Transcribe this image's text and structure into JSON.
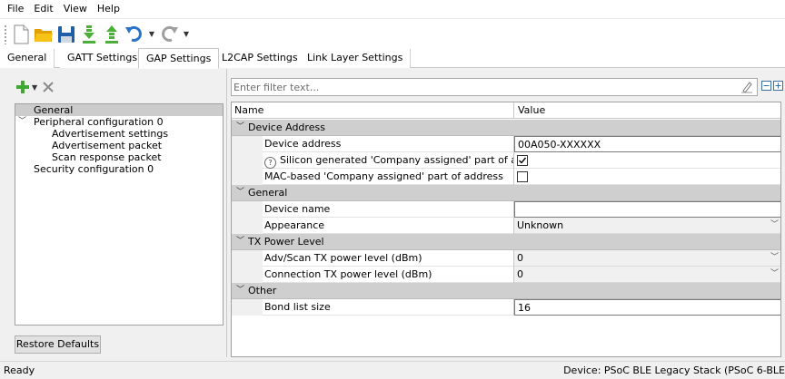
{
  "menu": [
    "File",
    "Edit",
    "View",
    "Help"
  ],
  "toolbar": {
    "icons": [
      "new-document-icon",
      "open-folder-icon",
      "save-icon",
      "import-icon",
      "export-icon",
      "undo-icon",
      "redo-icon"
    ],
    "colors": {
      "folder": "#f2b600",
      "save": "#1f5fa8",
      "arrows": "#4caf3a",
      "undo": "#2a73c9",
      "redo": "#9e9e9e"
    }
  },
  "tabs": [
    "General",
    "GATT Settings",
    "GAP Settings",
    "L2CAP Settings",
    "Link Layer Settings"
  ],
  "active_tab": "GAP Settings",
  "tree": [
    {
      "label": "General",
      "level": 0,
      "selected": true
    },
    {
      "label": "Peripheral configuration 0",
      "level": 0,
      "expanded": true
    },
    {
      "label": "Advertisement settings",
      "level": 2
    },
    {
      "label": "Advertisement packet",
      "level": 2
    },
    {
      "label": "Scan response packet",
      "level": 2
    },
    {
      "label": "Security configuration 0",
      "level": 0
    }
  ],
  "restore_defaults": "Restore Defaults",
  "filter": {
    "placeholder": "Enter filter text...",
    "value": ""
  },
  "grid": {
    "columns": [
      "Name",
      "Value"
    ],
    "categories": [
      {
        "label": "Device Address",
        "rows": [
          {
            "name": "Device address",
            "type": "text",
            "value": "00A050-XXXXXX"
          },
          {
            "name": "Silicon generated 'Company assigned' part of address",
            "type": "checkbox",
            "checked": true,
            "help": true
          },
          {
            "name": "MAC-based 'Company assigned' part of address",
            "type": "checkbox",
            "checked": false
          }
        ]
      },
      {
        "label": "General",
        "rows": [
          {
            "name": "Device name",
            "type": "text",
            "value": ""
          },
          {
            "name": "Appearance",
            "type": "combo",
            "value": "Unknown"
          }
        ]
      },
      {
        "label": "TX Power Level",
        "rows": [
          {
            "name": "Adv/Scan TX power level (dBm)",
            "type": "combo",
            "value": "0"
          },
          {
            "name": "Connection TX power level (dBm)",
            "type": "combo",
            "value": "0"
          }
        ]
      },
      {
        "label": "Other",
        "rows": [
          {
            "name": "Bond list size",
            "type": "text",
            "value": "16"
          }
        ]
      }
    ]
  },
  "status": {
    "left": "Ready",
    "right": "Device: PSoC BLE Legacy Stack (PSoC 6-BLE"
  }
}
